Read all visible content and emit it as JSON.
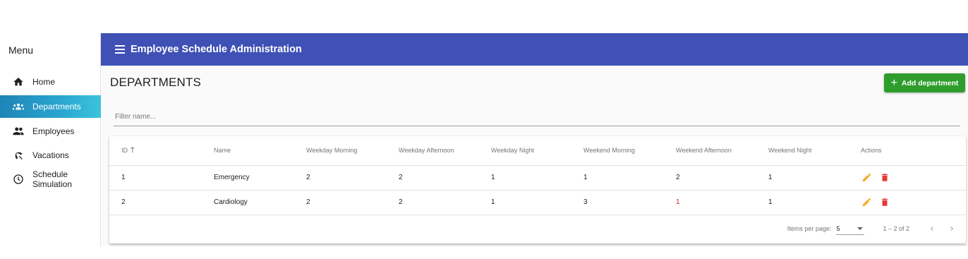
{
  "sidebar": {
    "title": "Menu",
    "items": [
      {
        "label": "Home",
        "icon": "home-icon"
      },
      {
        "label": "Departments",
        "icon": "groups-icon",
        "active": true
      },
      {
        "label": "Employees",
        "icon": "people-icon"
      },
      {
        "label": "Vacations",
        "icon": "beach-icon"
      },
      {
        "label_line1": "Schedule",
        "label_line2": "Simulation",
        "icon": "clock-icon"
      }
    ]
  },
  "topbar": {
    "title": "Employee Schedule Administration",
    "color": "#3f51b5"
  },
  "main": {
    "page_title": "DEPARTMENTS",
    "add_button": "Add department",
    "add_button_color": "#2e9d2b",
    "filter_placeholder": "Filter name...",
    "filter_value": ""
  },
  "table": {
    "columns": [
      "ID",
      "Name",
      "Weekday Morning",
      "Weekday Afternoon",
      "Weekday Night",
      "Weekend Morning",
      "Weekend Afternoon",
      "Weekend Night",
      "Actions"
    ],
    "sort_column": "ID",
    "sort_direction": "ascending",
    "rows": [
      {
        "id": "1",
        "name": "Emergency",
        "wd_morning": "2",
        "wd_afternoon": "2",
        "wd_night": "1",
        "we_morning": "1",
        "we_afternoon": "2",
        "we_night": "1"
      },
      {
        "id": "2",
        "name": "Cardiology",
        "wd_morning": "2",
        "wd_afternoon": "2",
        "wd_night": "1",
        "we_morning": "3",
        "we_afternoon": "1",
        "we_night": "1"
      }
    ],
    "edit_icon_color": "#f9a825",
    "delete_icon_color": "#e53935"
  },
  "paginator": {
    "items_per_page_label": "Items per page:",
    "items_per_page": "5",
    "range": "1 – 2 of 2"
  }
}
